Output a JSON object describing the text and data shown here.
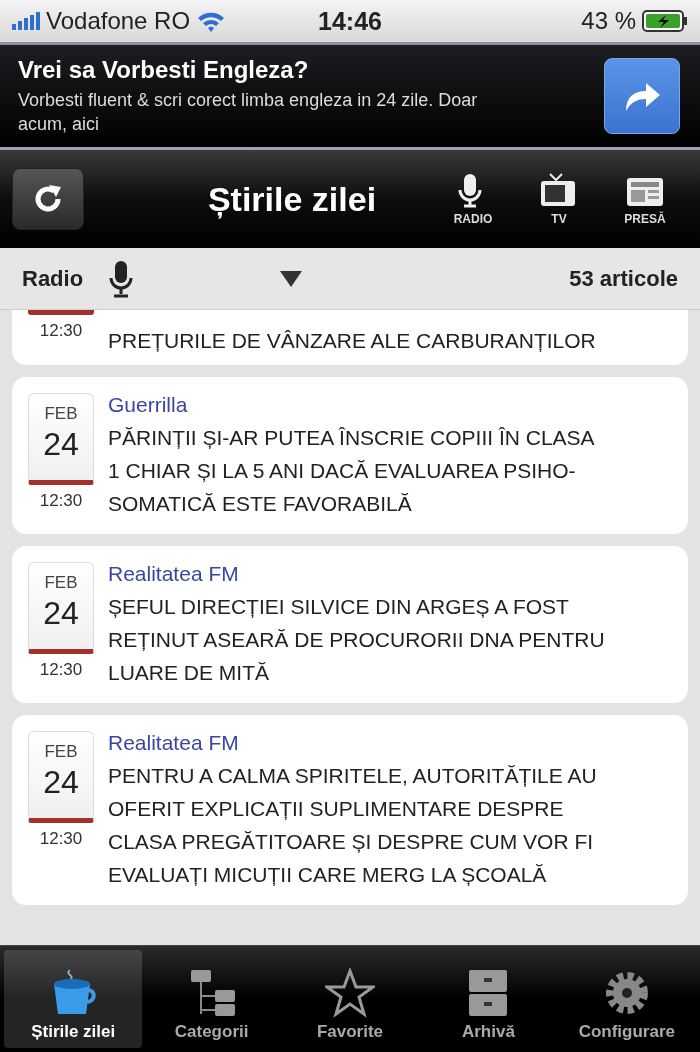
{
  "status_bar": {
    "carrier": "Vodafone RO",
    "time": "14:46",
    "battery": "43 %"
  },
  "ad": {
    "title": "Vrei sa Vorbesti Engleza?",
    "text": "Vorbesti fluent & scri corect limba engleza in 24 zile. Doar acum, aici"
  },
  "nav_bar": {
    "title": "Știrile zilei",
    "buttons": [
      {
        "kind": "radio",
        "label": "RADIO"
      },
      {
        "kind": "tv",
        "label": "TV"
      },
      {
        "kind": "press",
        "label": "PRESĂ"
      }
    ]
  },
  "filter_bar": {
    "label": "Radio",
    "count": "53 articole"
  },
  "articles": [
    {
      "time": "12:30",
      "headline": [
        "PREȚURILE DE VÂNZARE ALE CARBURANȚILOR"
      ]
    },
    {
      "month": "FEB",
      "day": "24",
      "time": "12:30",
      "source": "Guerrilla",
      "headline": [
        "PĂRINȚII ȘI-AR PUTEA ÎNSCRIE COPIII ÎN CLASA",
        "1 CHIAR ȘI LA 5 ANI DACĂ EVALUAREA PSIHO-",
        "SOMATICĂ ESTE FAVORABILĂ"
      ]
    },
    {
      "month": "FEB",
      "day": "24",
      "time": "12:30",
      "source": "Realitatea FM",
      "headline": [
        "ȘEFUL DIRECȚIEI SILVICE DIN ARGEȘ A FOST",
        "REȚINUT ASEARĂ DE PROCURORII DNA PENTRU",
        "LUARE DE MITĂ"
      ]
    },
    {
      "month": "FEB",
      "day": "24",
      "time": "12:30",
      "source": "Realitatea FM",
      "headline": [
        "PENTRU A CALMA SPIRITELE, AUTORITĂȚILE AU",
        "OFERIT EXPLICAȚII SUPLIMENTARE DESPRE",
        "CLASA PREGĂTITOARE ȘI DESPRE CUM VOR FI",
        "EVALUAȚI MICUȚII CARE MERG LA ȘCOALĂ"
      ]
    }
  ],
  "tab_bar": [
    {
      "kind": "cup",
      "label": "Știrile zilei",
      "selected": true
    },
    {
      "kind": "tree",
      "label": "Categorii",
      "selected": false
    },
    {
      "kind": "star",
      "label": "Favorite",
      "selected": false
    },
    {
      "kind": "drawers",
      "label": "Arhivă",
      "selected": false
    },
    {
      "kind": "gear",
      "label": "Configurare",
      "selected": false
    }
  ]
}
